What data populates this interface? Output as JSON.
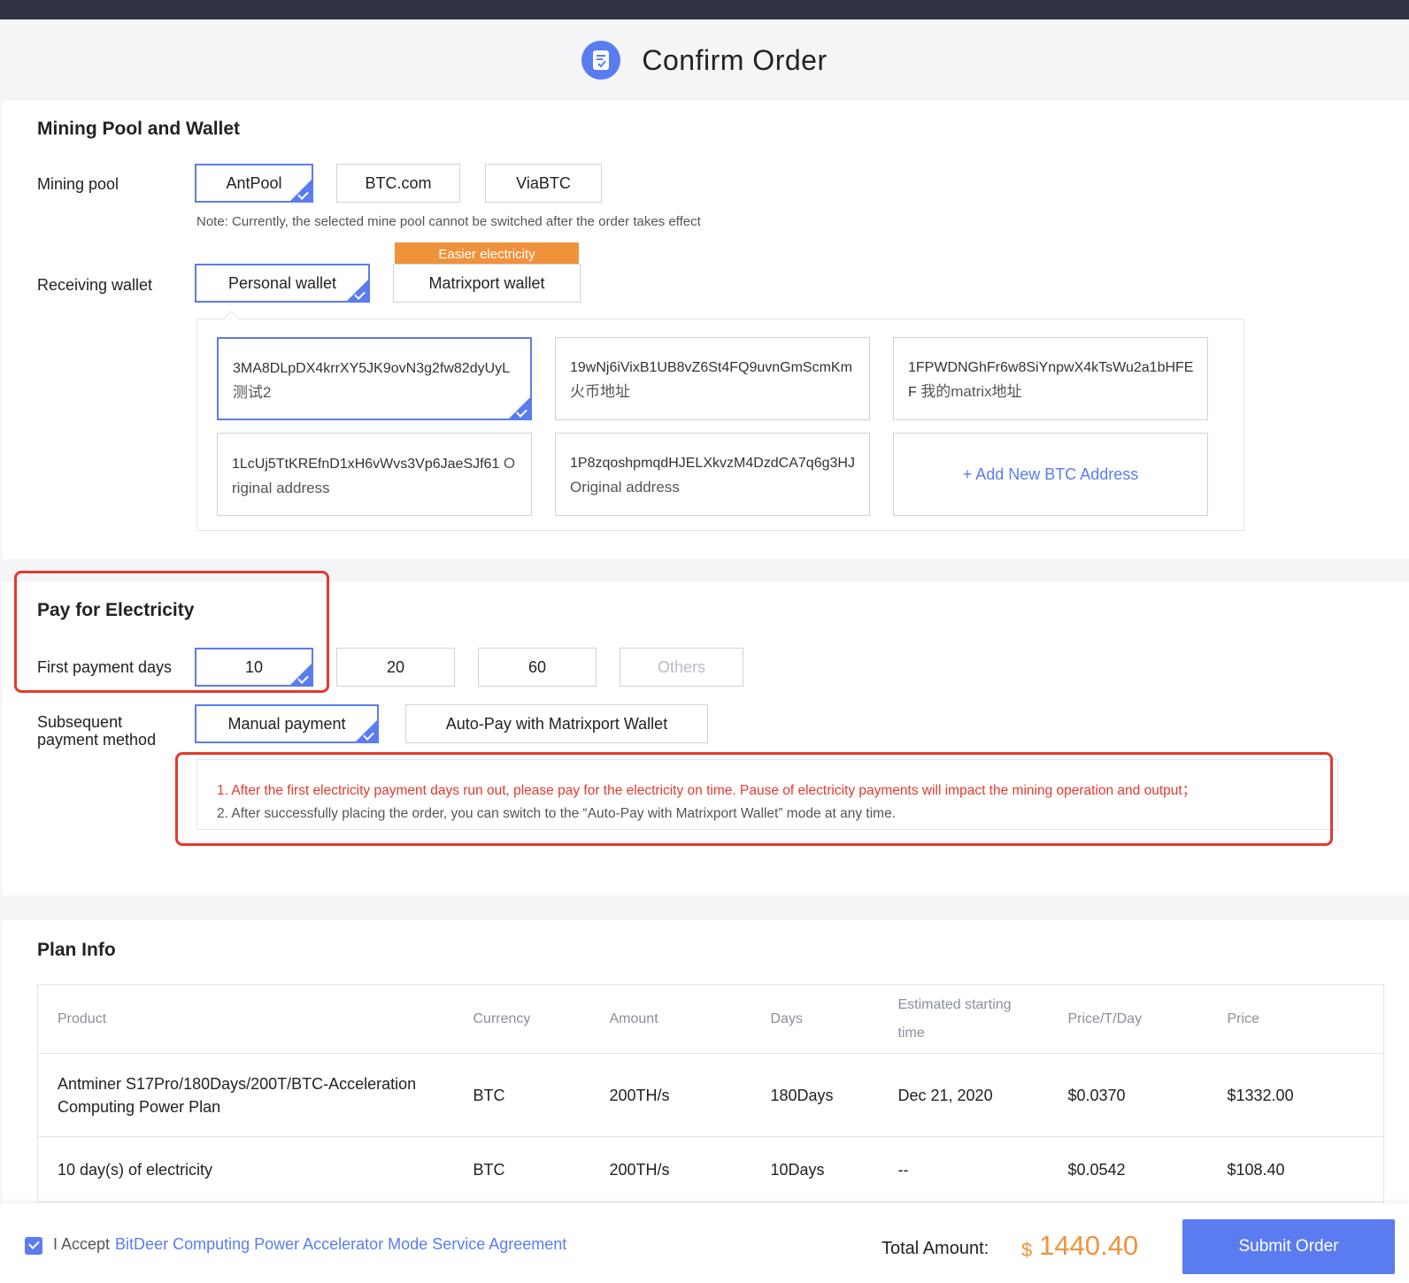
{
  "header": {
    "title": "Confirm Order",
    "icon": "order-confirm-icon"
  },
  "pool_wallet": {
    "section_title": "Mining Pool and Wallet",
    "pool_label": "Mining pool",
    "pools": [
      "AntPool",
      "BTC.com",
      "ViaBTC"
    ],
    "selected_pool": "AntPool",
    "note": "Note: Currently, the selected mine pool cannot be switched after the order takes effect",
    "wallet_label": "Receiving wallet",
    "wallets": [
      "Personal wallet",
      "Matrixport wallet"
    ],
    "selected_wallet": "Personal wallet",
    "badge": "Easier electricity",
    "addresses": [
      {
        "address": "3MA8DLpDX4krrXY5JK9ovN3g2fw82dyUyL",
        "label": "测试2"
      },
      {
        "address": "19wNj6iVixB1UB8vZ6St4FQ9uvnGmScmKm",
        "label": "火币地址"
      },
      {
        "address": "1FPWDNGhFr6w8SiYnpwX4kTsWu2a1bHFEF",
        "label": "我的matrix地址"
      },
      {
        "address": "1LcUj5TtKREfnD1xH6vWvs3Vp6JaeSJf61",
        "label": "Original address"
      },
      {
        "address": "1P8zqoshpmqdHJELXkvzM4DzdCA7q6g3HJ",
        "label": "Original address"
      }
    ],
    "selected_address_index": 0,
    "add_address": "+ Add New BTC Address"
  },
  "electricity": {
    "section_title": "Pay for Electricity",
    "days_label": "First payment days",
    "days_options": [
      "10",
      "20",
      "60",
      "Others"
    ],
    "selected_days": "10",
    "method_label_line1": "Subsequent",
    "method_label_line2": "payment method",
    "methods": [
      "Manual payment",
      "Auto-Pay with Matrixport Wallet"
    ],
    "selected_method": "Manual payment",
    "tip1": "1. After the first electricity payment days run out, please pay for the electricity on time. Pause of electricity payments will impact the mining operation and output；",
    "tip2": "2. After successfully placing the order, you can switch to the “Auto-Pay with Matrixport Wallet” mode at any time."
  },
  "plan": {
    "section_title": "Plan Info",
    "columns": [
      "Product",
      "Currency",
      "Amount",
      "Days",
      "Estimated starting time",
      "Price/T/Day",
      "Price"
    ],
    "rows": [
      [
        "Antminer S17Pro/180Days/200T/BTC-Acceleration Computing Power Plan",
        "BTC",
        "200TH/s",
        "180Days",
        "Dec 21, 2020",
        "$0.0370",
        "$1332.00"
      ],
      [
        "10 day(s) of electricity",
        "BTC",
        "200TH/s",
        "10Days",
        "--",
        "$0.0542",
        "$108.40"
      ]
    ]
  },
  "footer": {
    "accept_prefix": "I Accept",
    "agreement": "BitDeer Computing Power Accelerator Mode Service Agreement",
    "total_label": "Total Amount:",
    "currency_symbol": "$",
    "total": "1440.40",
    "submit": "Submit Order"
  },
  "colors": {
    "accent": "#5b7cf0",
    "orange": "#f0923c",
    "alert_red": "#e23a2e",
    "topbar": "#2e3242"
  }
}
